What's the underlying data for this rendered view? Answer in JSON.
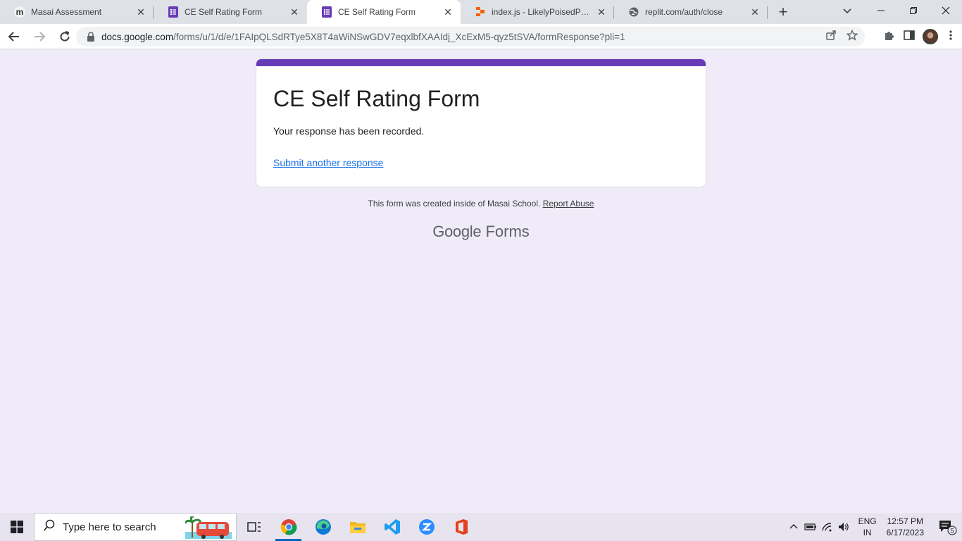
{
  "browser": {
    "tabs": [
      {
        "title": "Masai Assessment",
        "icon": "masai-m-icon",
        "active": false
      },
      {
        "title": "CE Self Rating Form",
        "icon": "google-forms-icon",
        "active": false
      },
      {
        "title": "CE Self Rating Form",
        "icon": "google-forms-icon",
        "active": true
      },
      {
        "title": "index.js - LikelyPoisedPaint -",
        "icon": "replit-icon",
        "active": false
      },
      {
        "title": "replit.com/auth/close",
        "icon": "globe-icon",
        "active": false
      }
    ],
    "url_host": "docs.google.com",
    "url_path": "/forms/u/1/d/e/1FAIpQLSdRTye5X8T4aWiNSwGDV7eqxlbfXAAIdj_XcExM5-qyz5tSVA/formResponse?pli=1"
  },
  "form": {
    "title": "CE Self Rating Form",
    "message": "Your response has been recorded.",
    "link_label": "Submit another response",
    "accent_color": "#673ab7"
  },
  "footer": {
    "note": "This form was created inside of Masai School.",
    "abuse_label": "Report Abuse",
    "brand_google": "Google",
    "brand_forms": "Forms"
  },
  "taskbar": {
    "search_placeholder": "Type here to search",
    "lang_top": "ENG",
    "lang_bottom": "IN",
    "time": "12:57 PM",
    "date": "6/17/2023",
    "notification_count": "5"
  }
}
